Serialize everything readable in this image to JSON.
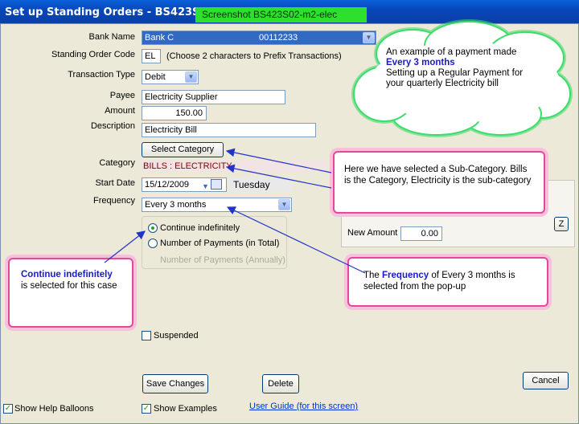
{
  "window": {
    "title": "Set up Standing Orders - BS423S02",
    "screenshot_label": "Screenshot BS423S02-m2-elec"
  },
  "form": {
    "bank_name": {
      "label": "Bank Name",
      "value": "Bank C",
      "account": "00112233"
    },
    "order_code": {
      "label": "Standing Order Code",
      "value": "EL",
      "hint": "(Choose 2 characters to Prefix Transactions)"
    },
    "transaction_type": {
      "label": "Transaction Type",
      "value": "Debit"
    },
    "payee": {
      "label": "Payee",
      "value": "Electricity Supplier"
    },
    "amount": {
      "label": "Amount",
      "value": "150.00"
    },
    "description": {
      "label": "Description",
      "value": "Electricity Bill"
    },
    "select_category_button": "Select Category",
    "category": {
      "label": "Category",
      "value": "BILLS : ELECTRICITY"
    },
    "start_date": {
      "label": "Start Date",
      "value": "15/12/2009",
      "weekday": "Tuesday"
    },
    "frequency": {
      "label": "Frequency",
      "value": "Every 3 months"
    },
    "radio_continue": "Continue indefinitely",
    "radio_number": "Number of Payments (in Total)",
    "payments_annually": "Number of Payments (Annually)",
    "suspended": "Suspended",
    "new_amount": {
      "label": "New Amount",
      "value": "0.00"
    },
    "z_button": "Z"
  },
  "buttons": {
    "save": "Save Changes",
    "delete": "Delete",
    "cancel": "Cancel"
  },
  "footer": {
    "help_balloons": "Show Help Balloons",
    "examples": "Show Examples",
    "guide": "User Guide (for this screen)"
  },
  "balloons": {
    "cloud": {
      "line1": "An example of a payment made",
      "highlight": "Every 3 months",
      "line2": "Setting up a Regular Payment for your quarterly Electricity bill"
    },
    "subcategory": "Here we have selected a Sub-Category. Bills is the Category, Electricity is the sub-category",
    "continue": {
      "highlight": "Continue indefinitely",
      "rest": "is selected for this case"
    },
    "frequency": {
      "pre": "The",
      "highlight": "Frequency",
      "rest": "of Every 3 months is selected from the pop-up"
    }
  },
  "colors": {
    "title_bar": "#0846b8",
    "screenshot_label": "#2ee02e",
    "callout_border": "#e5479a",
    "cloud_border": "#3ddc6a",
    "arrow": "#2233cc"
  }
}
